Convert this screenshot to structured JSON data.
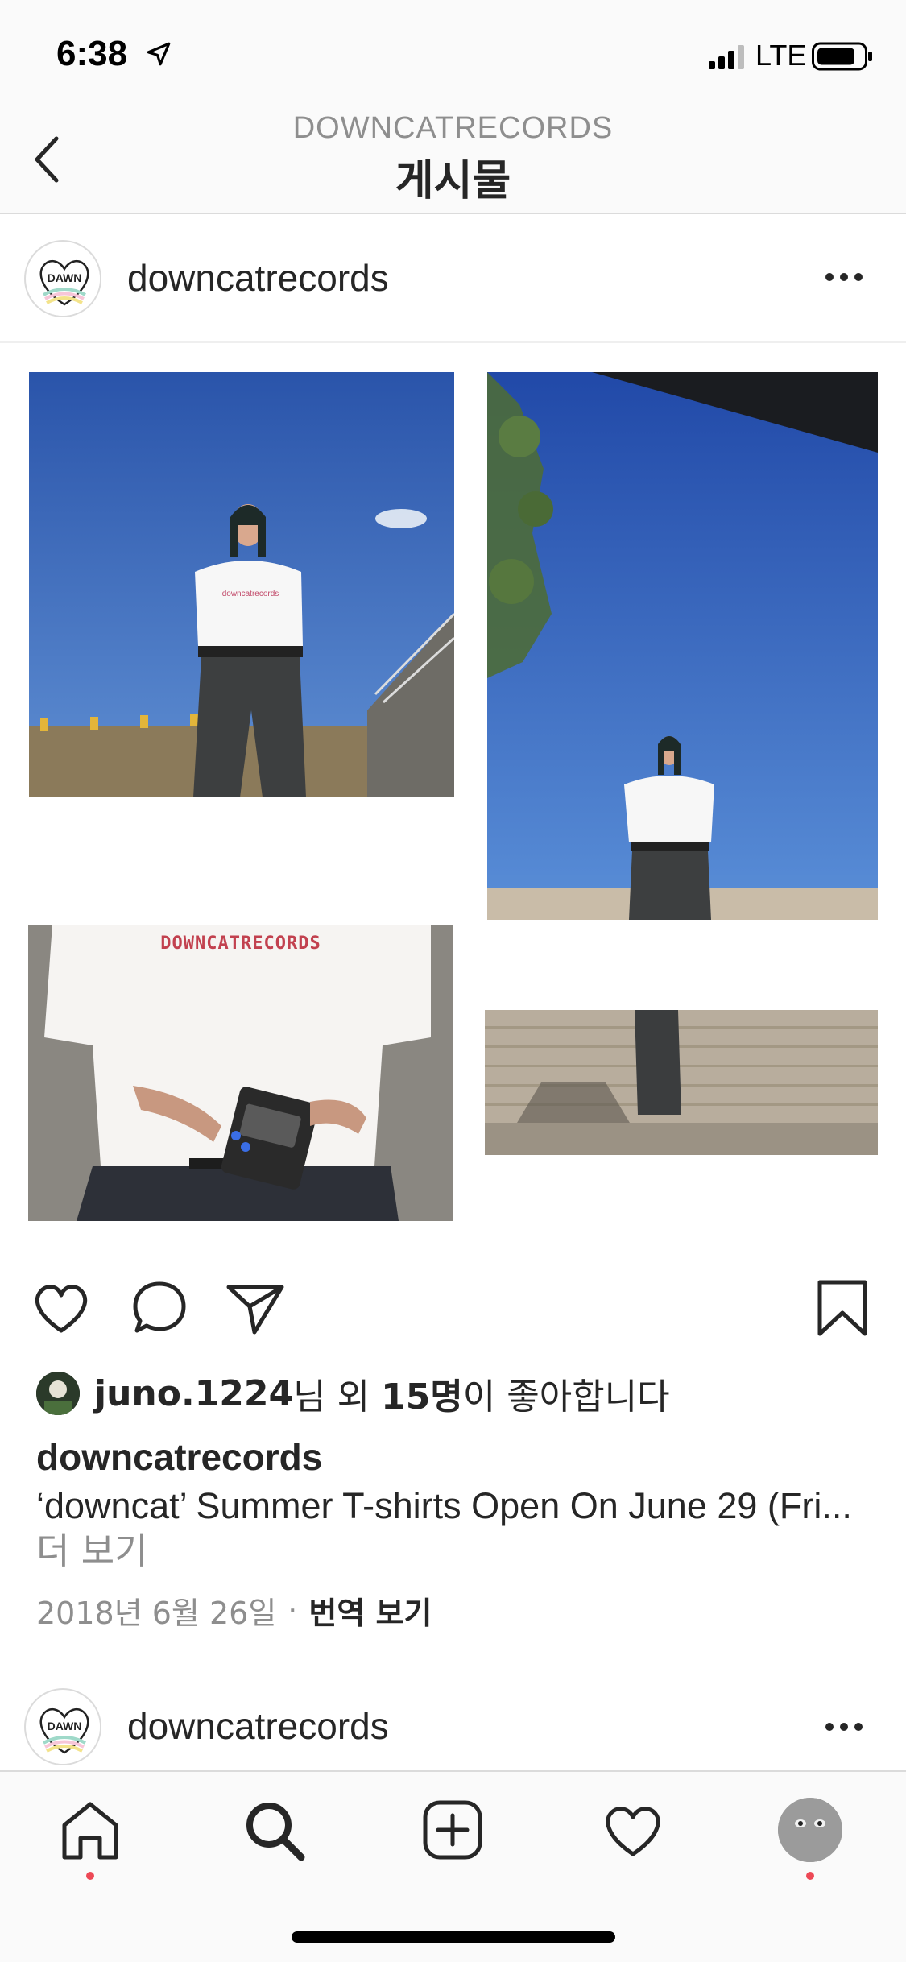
{
  "status_bar": {
    "time": "6:38",
    "network": "LTE",
    "icons": [
      "location-arrow-icon",
      "signal-icon",
      "battery-icon"
    ]
  },
  "header": {
    "account": "DOWNCATRECORDS",
    "title": "게시물",
    "back_icon": "chevron-left-icon"
  },
  "post": {
    "username": "downcatrecords",
    "photos": [
      "woman-white-tshirt-under-sky",
      "woman-standing-on-steps",
      "tshirt-logo-closeup-walkman",
      "legs-on-steps"
    ],
    "tshirt_print": "DOWNCATRECORDS",
    "actions": {
      "like_icon": "heart-icon",
      "comment_icon": "comment-icon",
      "share_icon": "paper-plane-icon",
      "save_icon": "bookmark-icon"
    },
    "likes": {
      "user": "juno.1224",
      "suffix_1": "님 외 ",
      "count": "15명",
      "suffix_2": "이 좋아합니다"
    },
    "caption": {
      "user": "downcatrecords",
      "text": "‘downcat’ Summer T-shirts Open On June 29 (Fri...",
      "more": " 더 보기"
    },
    "date": "2018년 6월 26일",
    "separator": "·",
    "translate": "번역 보기"
  },
  "next_post": {
    "username": "downcatrecords"
  },
  "tab_bar": {
    "items": [
      "home-icon",
      "search-icon",
      "new-post-icon",
      "activity-heart-icon",
      "profile-avatar"
    ]
  },
  "colors": {
    "sky": "#2f5fb6",
    "accent_red": "#ed4956",
    "text": "#262626",
    "muted": "#8e8e8e"
  }
}
